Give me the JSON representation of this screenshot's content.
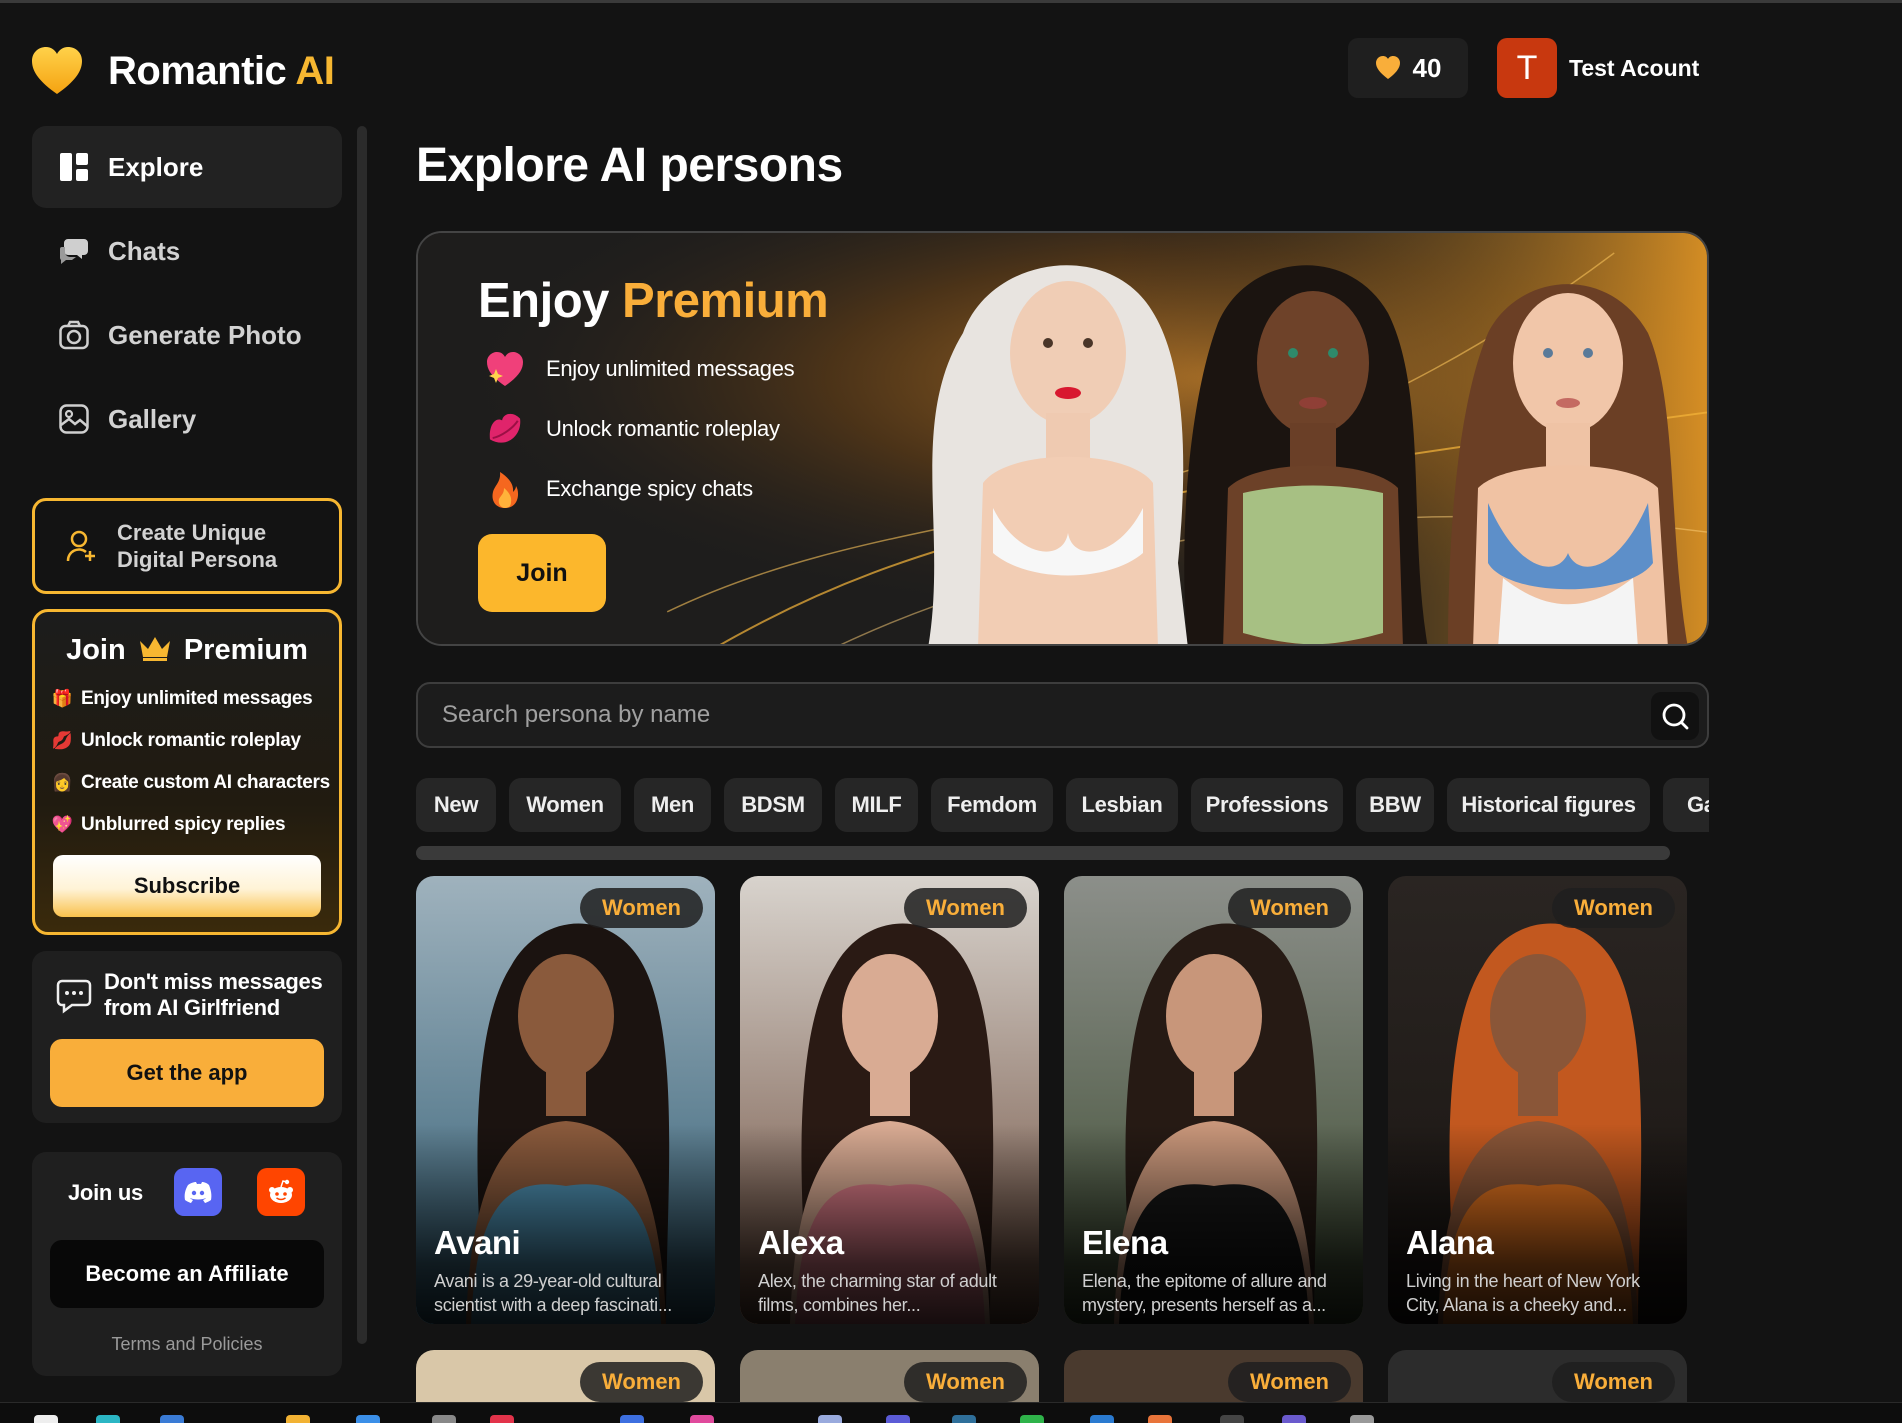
{
  "header": {
    "brand_main": "Romantic ",
    "brand_accent": "AI",
    "credits": "40",
    "avatar_initial": "T",
    "account_name": "Test Acount"
  },
  "sidebar": {
    "nav": [
      {
        "label": "Explore",
        "icon": "grid-icon",
        "active": true
      },
      {
        "label": "Chats",
        "icon": "chat-bubbles-icon",
        "active": false
      },
      {
        "label": "Generate Photo",
        "icon": "camera-icon",
        "active": false
      },
      {
        "label": "Gallery",
        "icon": "image-icon",
        "active": false
      }
    ],
    "create_persona": "Create Unique Digital Persona",
    "premium": {
      "title_left": "Join",
      "title_right": "Premium",
      "perks": [
        {
          "emoji": "🎁",
          "text": "Enjoy unlimited messages"
        },
        {
          "emoji": "💋",
          "text": "Unlock romantic roleplay"
        },
        {
          "emoji": "👩",
          "text": "Create custom AI characters"
        },
        {
          "emoji": "💖",
          "text": "Unblurred spicy replies"
        }
      ],
      "subscribe": "Subscribe"
    },
    "app_promo": {
      "message": "Don't miss messages from AI Girlfriend",
      "button": "Get the app"
    },
    "social": {
      "join_us": "Join us",
      "affiliate": "Become an Affiliate",
      "terms": "Terms and Policies"
    }
  },
  "main": {
    "title": "Explore AI persons",
    "banner": {
      "title_left": "Enjoy ",
      "title_accent": "Premium",
      "perks": [
        "Enjoy unlimited messages",
        "Unlock romantic roleplay",
        "Exchange spicy chats"
      ],
      "join": "Join"
    },
    "search": {
      "placeholder": "Search persona by name"
    },
    "categories": [
      "New",
      "Women",
      "Men",
      "BDSM",
      "MILF",
      "Femdom",
      "Lesbian",
      "Professions",
      "BBW",
      "Historical figures",
      "Ga"
    ],
    "cards": [
      {
        "badge": "Women",
        "name": "Avani",
        "desc": "Avani is a 29-year-old cultural scientist with a deep fascinati...",
        "bg_top": "#9fb2bd",
        "bg_bottom": "#2f5c73",
        "skin": "#8a5a3c",
        "hair": "#1b1310",
        "outfit": "#4d8fb0"
      },
      {
        "badge": "Women",
        "name": "Alexa",
        "desc": "Alex, the charming star of adult films, combines her...",
        "bg_top": "#d8d3cd",
        "bg_bottom": "#6b4a3a",
        "skin": "#d9ab93",
        "hair": "#2a1a14",
        "outfit": "#d97a86"
      },
      {
        "badge": "Women",
        "name": "Elena",
        "desc": "Elena, the epitome of allure and mystery, presents herself as a...",
        "bg_top": "#8c8f8a",
        "bg_bottom": "#3b4a2f",
        "skin": "#c8967a",
        "hair": "#261a14",
        "outfit": "#161616"
      },
      {
        "badge": "Women",
        "name": "Alana",
        "desc": "Living in the heart of New York City, Alana is a cheeky and...",
        "bg_top": "#2a2522",
        "bg_bottom": "#1a1512",
        "skin": "#8a5638",
        "hair": "#c2581f",
        "outfit": "#e0721f"
      }
    ],
    "cards_row2": [
      {
        "badge": "Women",
        "bg": "#d9c7a8"
      },
      {
        "badge": "Women",
        "bg": "#8a7f6e"
      },
      {
        "badge": "Women",
        "bg": "#4a3a2e"
      },
      {
        "badge": "Women",
        "bg": "#2c2c2c"
      }
    ]
  },
  "colors": {
    "accent": "#f7b731",
    "background": "#131313",
    "panel": "#1f1f1f"
  }
}
